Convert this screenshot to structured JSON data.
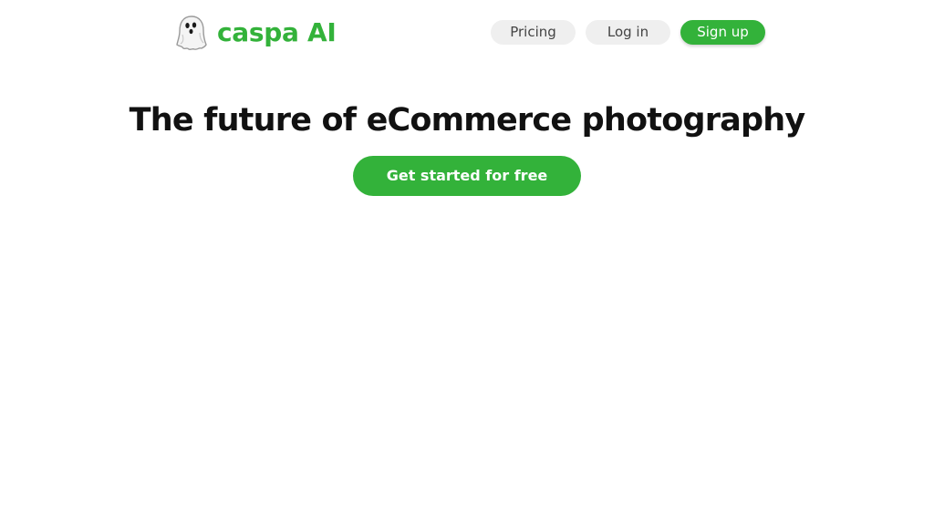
{
  "brand": {
    "name": "caspa AI",
    "logo_icon": "ghost-icon",
    "accent_color": "#33b23a"
  },
  "nav": {
    "pricing_label": "Pricing",
    "login_label": "Log in",
    "signup_label": "Sign up"
  },
  "hero": {
    "title": "The future of eCommerce photography",
    "cta_label": "Get started for free"
  }
}
